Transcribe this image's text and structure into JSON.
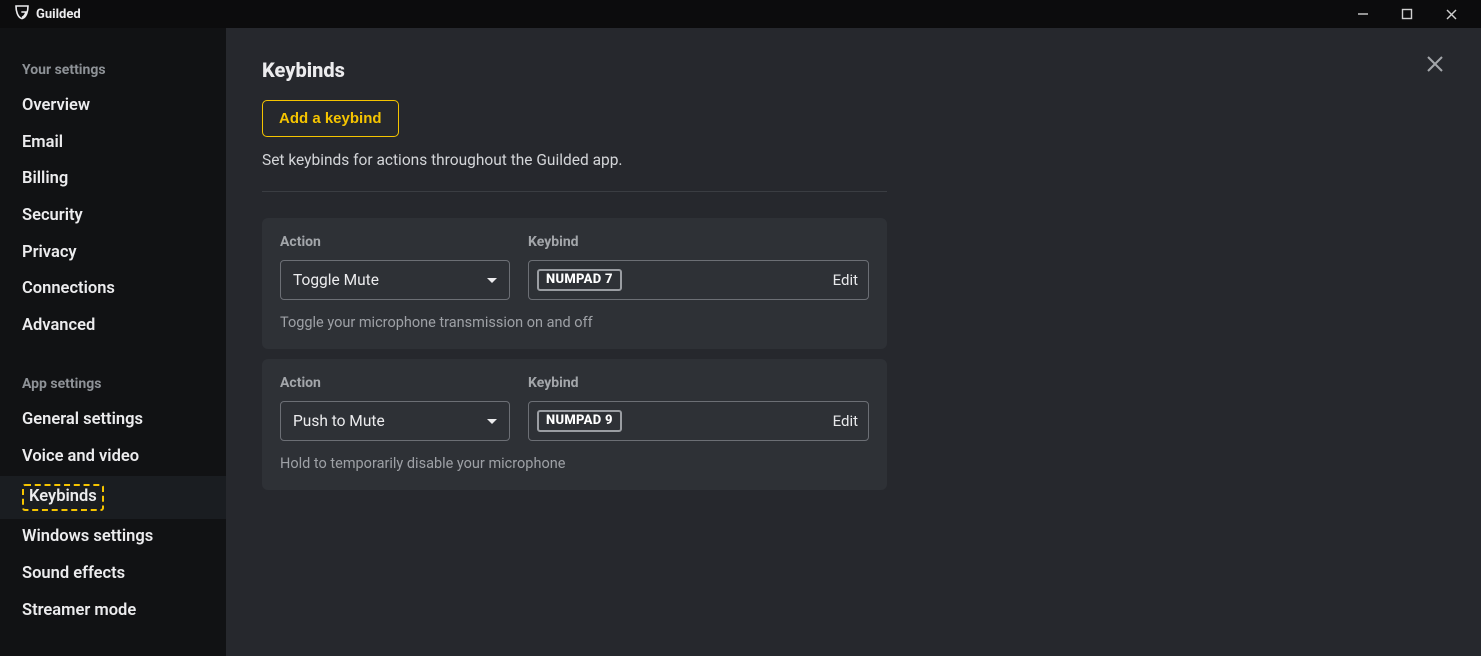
{
  "titlebar": {
    "title": "Guilded"
  },
  "sidebar": {
    "section_your": "Your settings",
    "section_app": "App settings",
    "your_items": [
      {
        "label": "Overview"
      },
      {
        "label": "Email"
      },
      {
        "label": "Billing"
      },
      {
        "label": "Security"
      },
      {
        "label": "Privacy"
      },
      {
        "label": "Connections"
      },
      {
        "label": "Advanced"
      }
    ],
    "app_items": [
      {
        "label": "General settings"
      },
      {
        "label": "Voice and video"
      },
      {
        "label": "Keybinds",
        "active": true
      },
      {
        "label": "Windows settings"
      },
      {
        "label": "Sound effects"
      },
      {
        "label": "Streamer mode"
      }
    ]
  },
  "page": {
    "title": "Keybinds",
    "add_label": "Add a keybind",
    "help": "Set keybinds for actions throughout the Guilded app.",
    "action_label": "Action",
    "keybind_label": "Keybind",
    "edit_label": "Edit"
  },
  "keybinds": [
    {
      "action": "Toggle Mute",
      "key": "NUMPAD 7",
      "desc": "Toggle your microphone transmission on and off"
    },
    {
      "action": "Push to Mute",
      "key": "NUMPAD 9",
      "desc": "Hold to temporarily disable your microphone"
    }
  ],
  "colors": {
    "accent": "#f5c400"
  }
}
